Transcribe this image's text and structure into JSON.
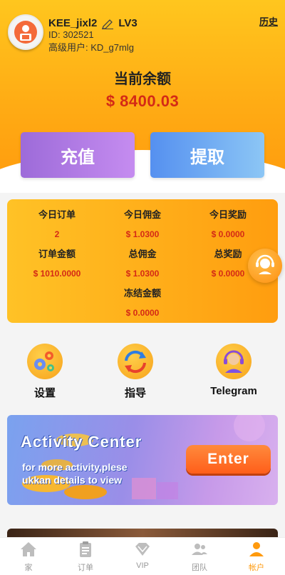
{
  "profile": {
    "username": "KEE_jixl2",
    "level": "LV3",
    "id_text": "ID: 302521",
    "user_level_text": "高级用户: KD_g7mlg",
    "history_label": "历史"
  },
  "balance": {
    "title": "当前余额",
    "amount": "$  8400.03"
  },
  "actions": {
    "recharge_label": "充值",
    "withdraw_label": "提取"
  },
  "stats": [
    {
      "label": "今日订单",
      "value": "2"
    },
    {
      "label": "今日佣金",
      "value": "$  1.0300"
    },
    {
      "label": "今日奖励",
      "value": "$ 0.0000"
    },
    {
      "label": "订单金额",
      "value": "$ 1010.0000"
    },
    {
      "label": "总佣金",
      "value": "$ 1.0300"
    },
    {
      "label": "总奖励",
      "value": "$ 0.0000"
    },
    {
      "label": "冻结金额",
      "value": "$ 0.0000"
    }
  ],
  "shortcuts": [
    {
      "label": "设置",
      "icon": "gears-icon"
    },
    {
      "label": "指导",
      "icon": "refresh-arrows-icon"
    },
    {
      "label": "Telegram",
      "icon": "headset-support-icon"
    }
  ],
  "banner": {
    "title": "Activity  Center",
    "subtitle_line1": "for more activity,plese",
    "subtitle_line2": "ukkan details to view",
    "enter_label": "Enter"
  },
  "tabbar": [
    {
      "label": "家",
      "icon": "home-icon",
      "active": false
    },
    {
      "label": "订单",
      "icon": "clipboard-icon",
      "active": false
    },
    {
      "label": "VIP",
      "icon": "diamond-icon",
      "active": false
    },
    {
      "label": "团队",
      "icon": "team-icon",
      "active": false
    },
    {
      "label": "帐户",
      "icon": "person-icon",
      "active": true
    }
  ],
  "colors": {
    "brand_orange": "#ff9a0d",
    "amount_red": "#d42a16",
    "recharge_purple": "#9d6bd9",
    "withdraw_blue": "#5590f0"
  }
}
